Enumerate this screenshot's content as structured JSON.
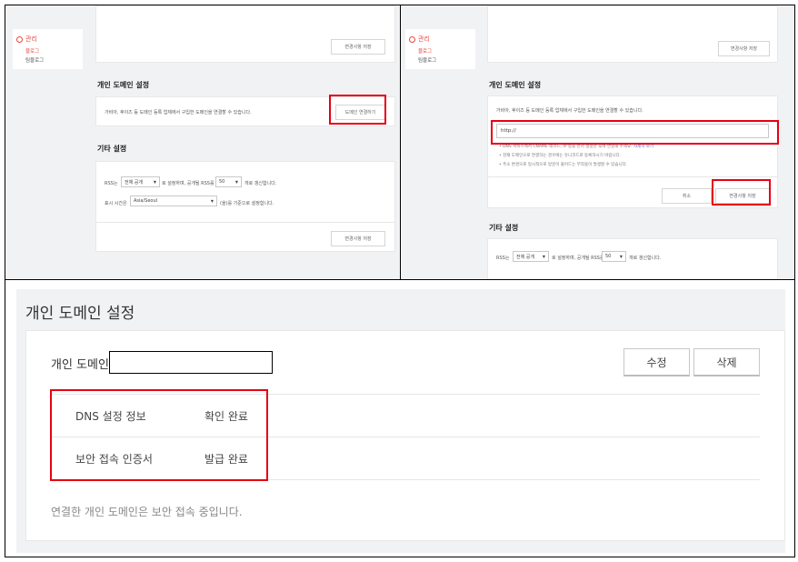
{
  "top_left": {
    "sidebar": {
      "title": "관리",
      "items": [
        "블로그",
        "팀블로그"
      ]
    },
    "top_save_button": "변경사항 저장",
    "domain_section": {
      "title": "개인 도메인 설정",
      "description": "가비아, 후이즈 등 도메인 등록 업체에서 구입한 도메인을 연결할 수 있습니다.",
      "connect_button": "도메인 연결하기"
    },
    "etc_section": {
      "title": "기타 설정",
      "rss_prefix": "RSS는",
      "rss_scope": "전체 공개",
      "rss_mid": "로 설정하며, 공개될 RSS를",
      "rss_count": "50",
      "rss_suffix": "개로 갱신합니다.",
      "tz_prefix": "표시 시간은",
      "tz_value": "Asia/Seoul",
      "tz_suffix": "(을)를 기준으로 설정합니다.",
      "save_button": "변경사항 저장"
    }
  },
  "top_right": {
    "sidebar": {
      "title": "관리",
      "items": [
        "블로그",
        "팀블로그"
      ]
    },
    "top_save_button": "변경사항 저장",
    "domain_section": {
      "title": "개인 도메인 설정",
      "description": "가비아, 후이즈 등 도메인 등록 업체에서 구입한 도메인을 연결할 수 있습니다.",
      "input_value": "http://",
      "notes": [
        "DNS 서비스에서 CNAME 레코드, IP 등을 먼저 설정한 후에 연결해 주세요.",
        "현재 도메인으로 연결하는 경우에는 유니코드로 등록하시기 바랍니다.",
        "주소 변경으로 일시적으로 방문이 줄어드는 부작용이 발생할 수 있습니다."
      ],
      "notes_link": "자세히 보기",
      "cancel_button": "취소",
      "save_button": "변경사항 저장"
    },
    "etc_section": {
      "title": "기타 설정",
      "rss_prefix": "RSS는",
      "rss_scope": "전체 공개",
      "rss_mid": "로 설정하며, 공개될 RSS를",
      "rss_count": "50",
      "rss_suffix": "개로 갱신합니다."
    }
  },
  "bottom": {
    "title": "개인 도메인 설정",
    "domain_label": "개인 도메인",
    "edit_button": "수정",
    "delete_button": "삭제",
    "rows": [
      {
        "label": "DNS 설정 정보",
        "value": "확인 완료"
      },
      {
        "label": "보안 접속 인증서",
        "value": "발급 완료"
      }
    ],
    "footer": "연결한 개인 도메인은 보안 접속 중입니다."
  },
  "colors": {
    "highlight": "#e60012",
    "accent": "#e8473d",
    "background": "#f1f2f4"
  }
}
